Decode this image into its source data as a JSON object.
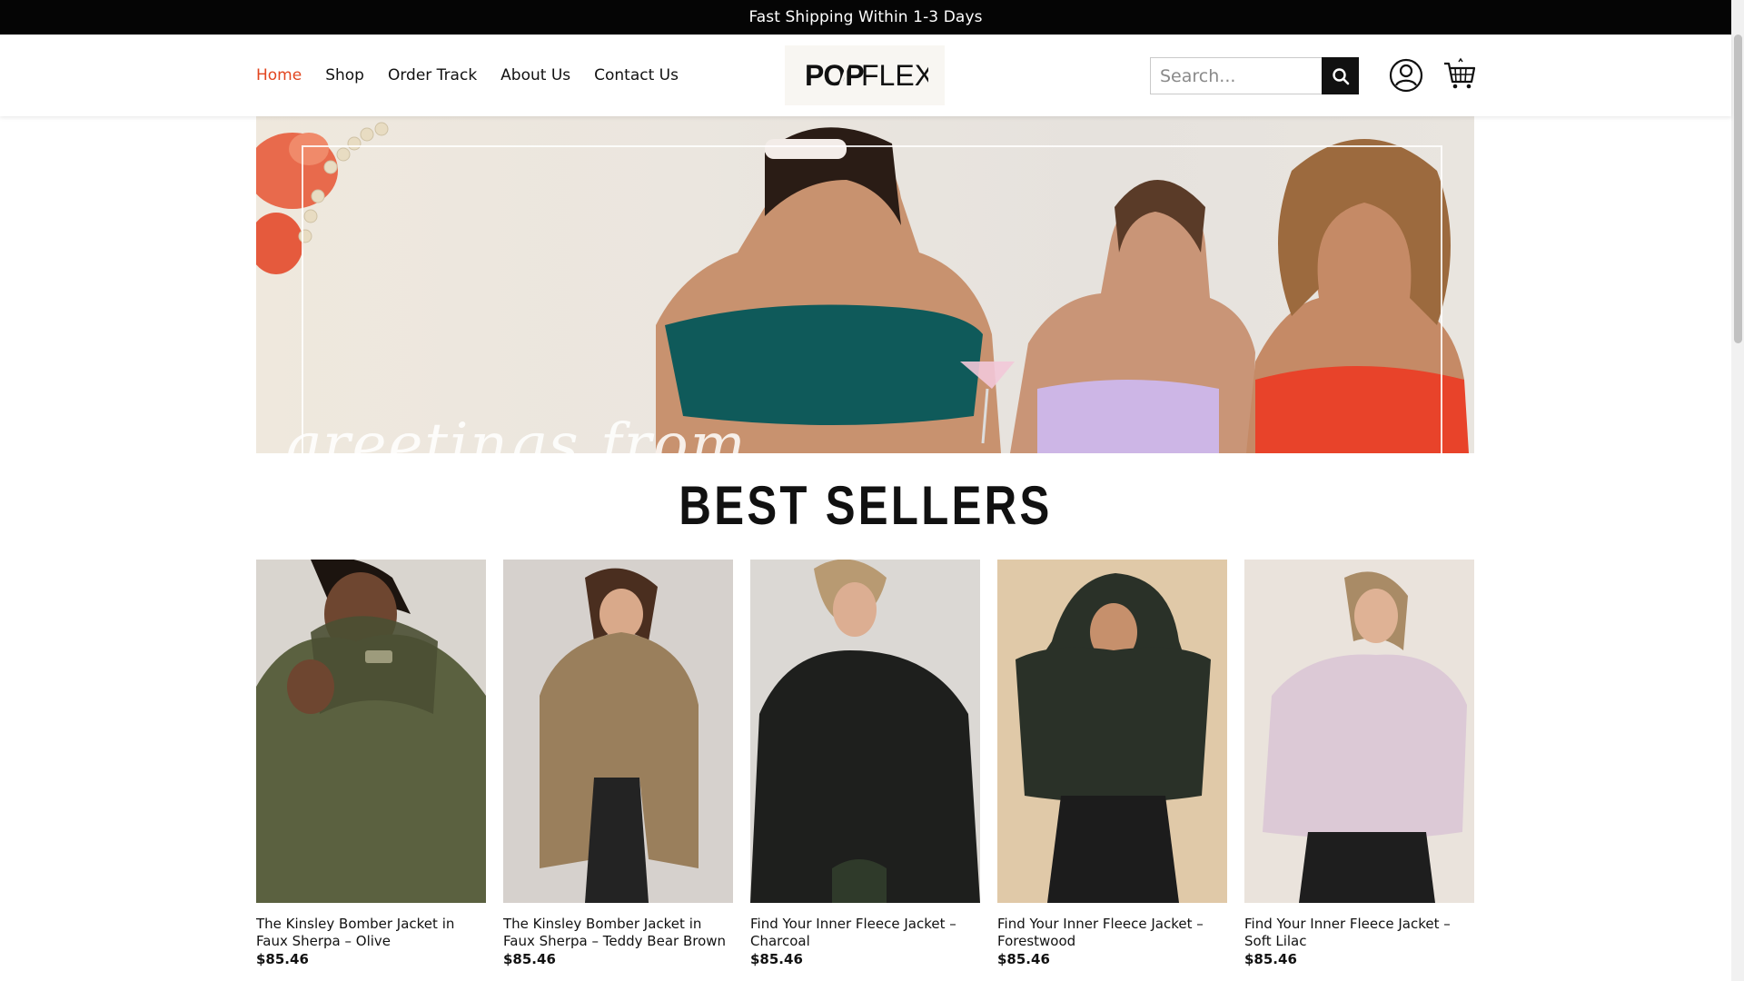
{
  "announcement": "Fast Shipping Within 1-3 Days",
  "nav": {
    "items": [
      "Home",
      "Shop",
      "Order Track",
      "About Us",
      "Contact Us"
    ],
    "active": "Home",
    "active_color": "#e2451f"
  },
  "logo": {
    "text_left": "POP",
    "text_right": "FLEX"
  },
  "search": {
    "placeholder": "Search...",
    "icon": "search-icon"
  },
  "header_icons": [
    "account-icon",
    "cart-icon"
  ],
  "hero": {
    "overlay_text": "greetings from"
  },
  "section_title": "BEST SELLERS",
  "products": [
    {
      "name": "The Kinsley Bomber Jacket in Faux Sherpa – Olive",
      "price": "$85.46",
      "color": "#5b6140"
    },
    {
      "name": "The Kinsley Bomber Jacket in Faux Sherpa – Teddy Bear Brown",
      "price": "$85.46",
      "color": "#9a7f5c"
    },
    {
      "name": "Find Your Inner Fleece Jacket – Charcoal",
      "price": "$85.46",
      "color": "#1e1f1d"
    },
    {
      "name": "Find Your Inner Fleece Jacket – Forestwood",
      "price": "$85.46",
      "color": "#2a3128"
    },
    {
      "name": "Find Your Inner Fleece Jacket – Soft Lilac",
      "price": "$85.46",
      "color": "#dcc9d6"
    }
  ]
}
